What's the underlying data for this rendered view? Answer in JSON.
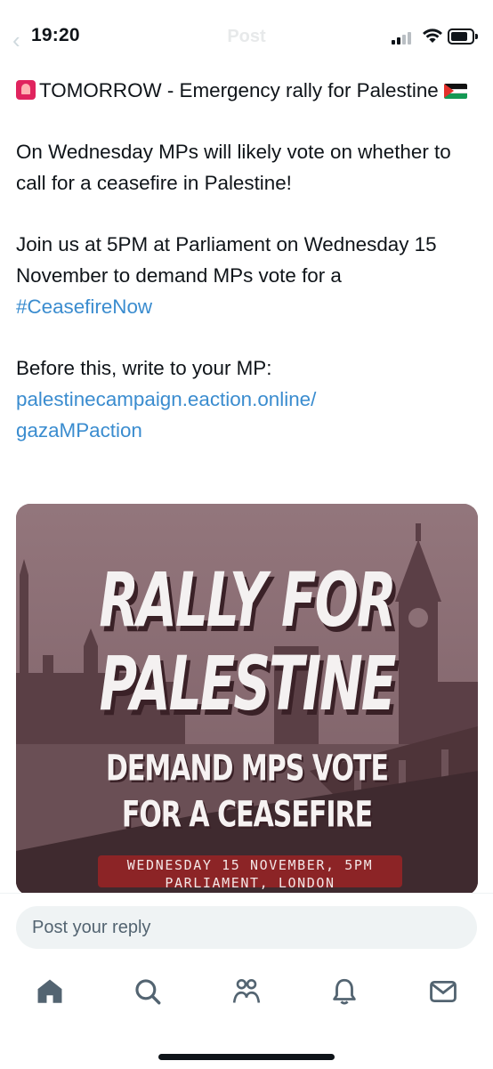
{
  "status_bar": {
    "time": "19:20",
    "title": "Post"
  },
  "tweet": {
    "line1": "TOMORROW - Emergency rally for Palestine",
    "para2": "On Wednesday MPs will likely vote on whether to call for a ceasefire in Palestine!",
    "para3_text": "Join us at 5PM at Parliament on Wednesday 15 November to demand MPs vote for a",
    "para3_hashtag": "#CeasefireNow",
    "para4_text": "Before this, write to your MP:",
    "para4_link_line1": "palestinecampaign.eaction.online/",
    "para4_link_line2": "gazaMPaction",
    "emoji_siren": "rotating-light-icon",
    "emoji_flag": "palestine-flag-icon"
  },
  "poster": {
    "headline1": "RALLY FOR",
    "headline2": "PALESTINE",
    "sub1": "DEMAND MPS VOTE",
    "sub2": "FOR A CEASEFIRE",
    "banner_line1": "WEDNESDAY 15 NOVEMBER, 5PM",
    "banner_line2": "PARLIAMENT, LONDON"
  },
  "reply": {
    "placeholder": "Post your reply"
  },
  "tabbar": {
    "items": [
      "home-icon",
      "search-icon",
      "communities-icon",
      "notifications-icon",
      "messages-icon"
    ]
  },
  "colors": {
    "link": "#3a8ccf",
    "text": "#0f1419",
    "reply_bg": "#eff3f4",
    "banner": "#8c2426"
  }
}
